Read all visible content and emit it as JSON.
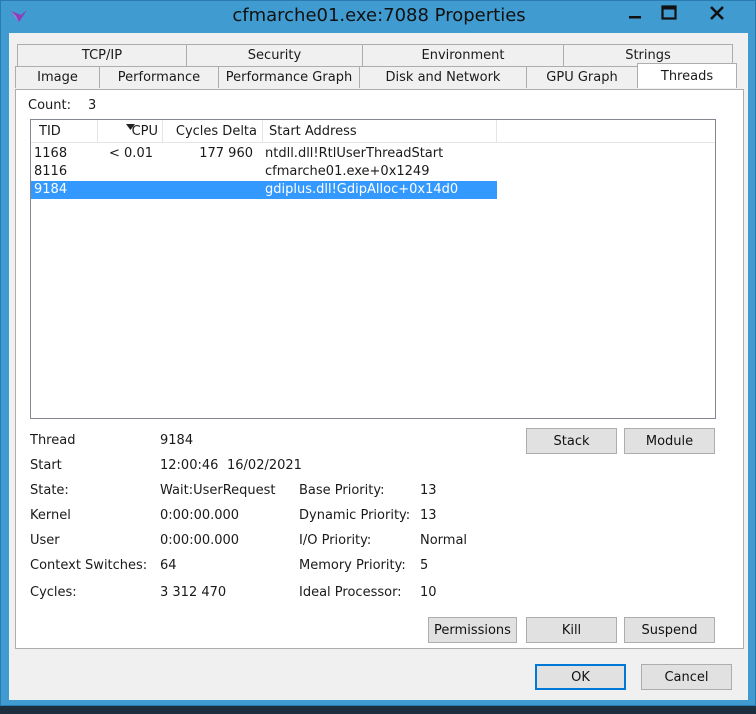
{
  "window": {
    "title": "cfmarche01.exe:7088 Properties",
    "caption_buttons": {
      "minimize": "minimize-icon",
      "maximize": "maximize-icon",
      "close": "close-icon"
    }
  },
  "tabs": {
    "row1": [
      "TCP/IP",
      "Security",
      "Environment",
      "Strings"
    ],
    "row2": [
      "Image",
      "Performance",
      "Performance Graph",
      "Disk and Network",
      "GPU Graph",
      "Threads"
    ],
    "active": "Threads"
  },
  "threads": {
    "count_label": "Count:",
    "count_value": "3",
    "columns": [
      "TID",
      "CPU",
      "Cycles Delta",
      "Start Address"
    ],
    "sort_column": "CPU",
    "rows": [
      {
        "tid": "1168",
        "cpu": "< 0.01",
        "cycles_delta": "177 960",
        "start_address": "ntdll.dll!RtlUserThreadStart"
      },
      {
        "tid": "8116",
        "cpu": "",
        "cycles_delta": "",
        "start_address": "cfmarche01.exe+0x1249"
      },
      {
        "tid": "9184",
        "cpu": "",
        "cycles_delta": "",
        "start_address": "gdiplus.dll!GdipAlloc+0x14d0"
      }
    ],
    "selected_row": 2
  },
  "details": {
    "thread_label": "Thread",
    "thread_value": "9184",
    "start_label": "Start",
    "start_time": "12:00:46",
    "start_date": "16/02/2021",
    "state_label": "State:",
    "state_value": "Wait:UserRequest",
    "kernel_label": "Kernel",
    "kernel_value": "0:00:00.000",
    "user_label": "User",
    "user_value": "0:00:00.000",
    "context_label": "Context Switches:",
    "context_value": "64",
    "cycles_label": "Cycles:",
    "cycles_value": "3 312 470",
    "base_priority_label": "Base Priority:",
    "base_priority_value": "13",
    "dynamic_priority_label": "Dynamic Priority:",
    "dynamic_priority_value": "13",
    "io_priority_label": "I/O Priority:",
    "io_priority_value": "Normal",
    "memory_priority_label": "Memory Priority:",
    "memory_priority_value": "5",
    "ideal_processor_label": "Ideal Processor:",
    "ideal_processor_value": "10"
  },
  "buttons": {
    "stack": "Stack",
    "module": "Module",
    "permissions": "Permissions",
    "kill": "Kill",
    "suspend": "Suspend",
    "ok": "OK",
    "cancel": "Cancel"
  },
  "colors": {
    "titlebar": "#3f9bd0",
    "selection": "#3399ff",
    "close_hover": "#c42b1c"
  }
}
